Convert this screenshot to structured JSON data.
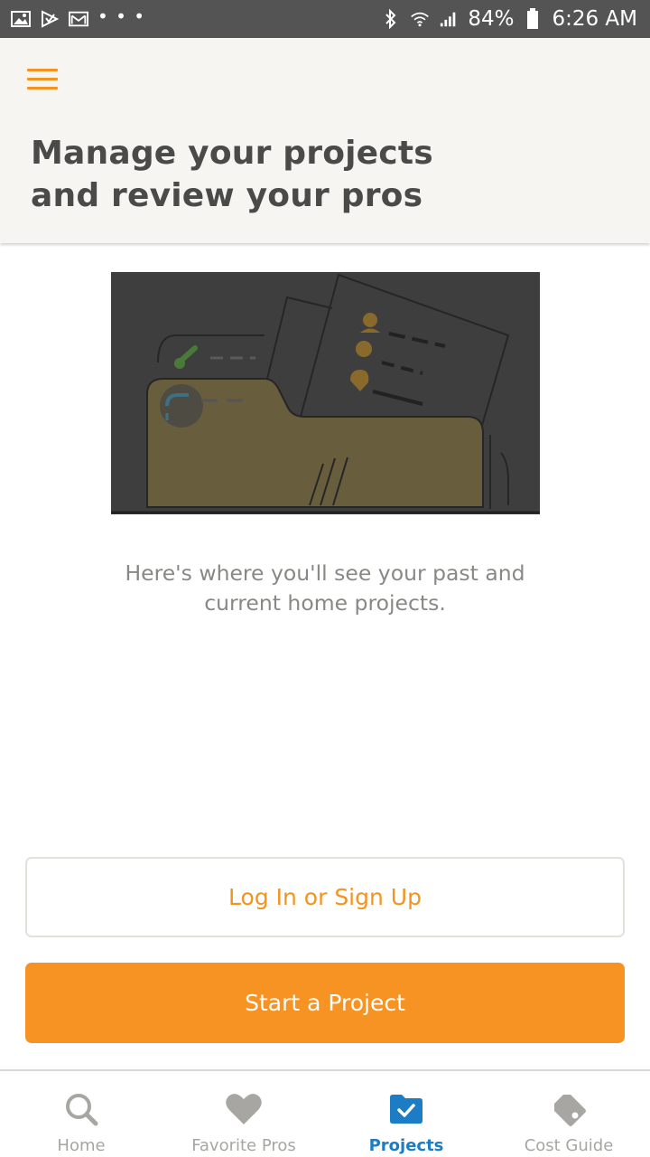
{
  "status_bar": {
    "icons_left": [
      "image-icon",
      "play-store-icon",
      "gmail-icon",
      "more-notifications-icon"
    ],
    "more": "• • •",
    "icons_right": [
      "bluetooth-icon",
      "wifi-icon",
      "signal-icon"
    ],
    "battery": "84%",
    "time": "6:26 AM"
  },
  "header": {
    "menu_icon": "hamburger-menu-icon",
    "title_line1": "Manage your projects",
    "title_line2": "and review your pros"
  },
  "main": {
    "illustration": "projects-folder-illustration",
    "empty_line1": "Here's where you'll see your past and",
    "empty_line2": "current home projects."
  },
  "buttons": {
    "login": "Log In or Sign Up",
    "start": "Start a Project"
  },
  "bottom_nav": {
    "items": [
      {
        "label": "Home",
        "icon": "search-icon"
      },
      {
        "label": "Favorite Pros",
        "icon": "heart-icon"
      },
      {
        "label": "Projects",
        "icon": "folder-check-icon",
        "active": true
      },
      {
        "label": "Cost Guide",
        "icon": "price-tag-icon"
      }
    ]
  },
  "colors": {
    "accent_orange": "#f69322",
    "active_blue": "#1c7cc6",
    "status_bar": "#545454",
    "header_bg": "#f6f5f1"
  }
}
